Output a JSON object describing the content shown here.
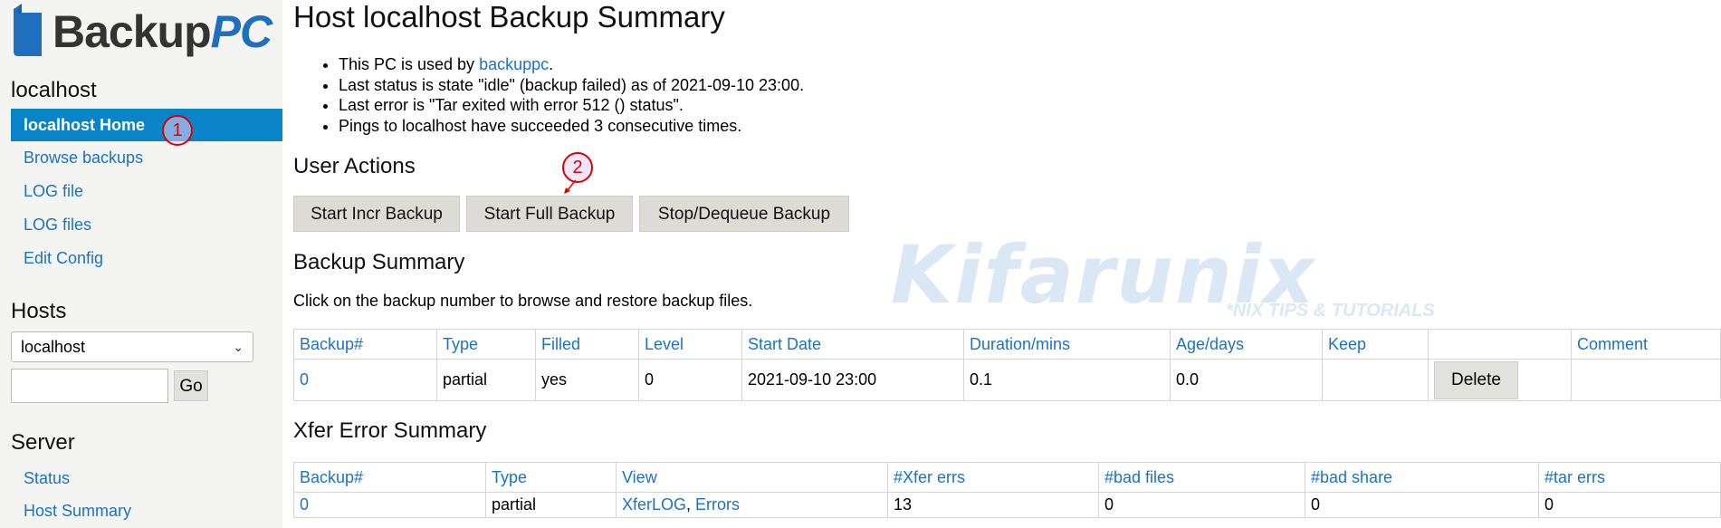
{
  "logo": {
    "text_dark": "Backup",
    "text_accent": "PC"
  },
  "sidebar": {
    "host_heading": "localhost",
    "host_nav": [
      {
        "label": "localhost Home",
        "active": true
      },
      {
        "label": "Browse backups"
      },
      {
        "label": "LOG file"
      },
      {
        "label": "LOG files"
      },
      {
        "label": "Edit Config"
      }
    ],
    "hosts_heading": "Hosts",
    "host_select_value": "localhost",
    "host_input_value": "",
    "go_label": "Go",
    "server_heading": "Server",
    "server_nav": [
      {
        "label": "Status"
      },
      {
        "label": "Host Summary"
      }
    ]
  },
  "page": {
    "title": "Host localhost Backup Summary",
    "status": {
      "item1_prefix": "This PC is used by ",
      "item1_link": "backuppc",
      "item1_suffix": ".",
      "item2": "Last status is state \"idle\" (backup failed) as of 2021-09-10 23:00.",
      "item3": "Last error is \"Tar exited with error 512 () status\".",
      "item4": "Pings to localhost have succeeded 3 consecutive times."
    },
    "user_actions_heading": "User Actions",
    "buttons": {
      "incr": "Start Incr Backup",
      "full": "Start Full Backup",
      "stop": "Stop/Dequeue Backup"
    },
    "backup_summary_heading": "Backup Summary",
    "backup_summary_text": "Click on the backup number to browse and restore backup files.",
    "backup_table": {
      "headers": [
        "Backup#",
        "Type",
        "Filled",
        "Level",
        "Start Date",
        "Duration/mins",
        "Age/days",
        "Keep",
        "",
        "Comment"
      ],
      "row": {
        "num": "0",
        "type": "partial",
        "filled": "yes",
        "level": "0",
        "start": "2021-09-10 23:00",
        "duration": "0.1",
        "age": "0.0",
        "keep": "",
        "delete_label": "Delete",
        "comment": ""
      }
    },
    "xfer_heading": "Xfer Error Summary",
    "xfer_table": {
      "headers": [
        "Backup#",
        "Type",
        "View",
        "#Xfer errs",
        "#bad files",
        "#bad share",
        "#tar errs"
      ],
      "row": {
        "num": "0",
        "type": "partial",
        "view_log": "XferLOG",
        "view_sep": ", ",
        "view_errors": "Errors",
        "xfer_errs": "13",
        "bad_files": "0",
        "bad_share": "0",
        "tar_errs": "0"
      }
    }
  },
  "annotations": {
    "marker1": "1",
    "marker2": "2"
  },
  "watermark": {
    "big": "Kifarunix",
    "small": "*NIX TIPS & TUTORIALS"
  },
  "colors": {
    "accent": "#0a84c9",
    "link": "#1a73c8",
    "sidebar_bg": "#f4f4f2",
    "button_bg": "#dcdcd4"
  }
}
